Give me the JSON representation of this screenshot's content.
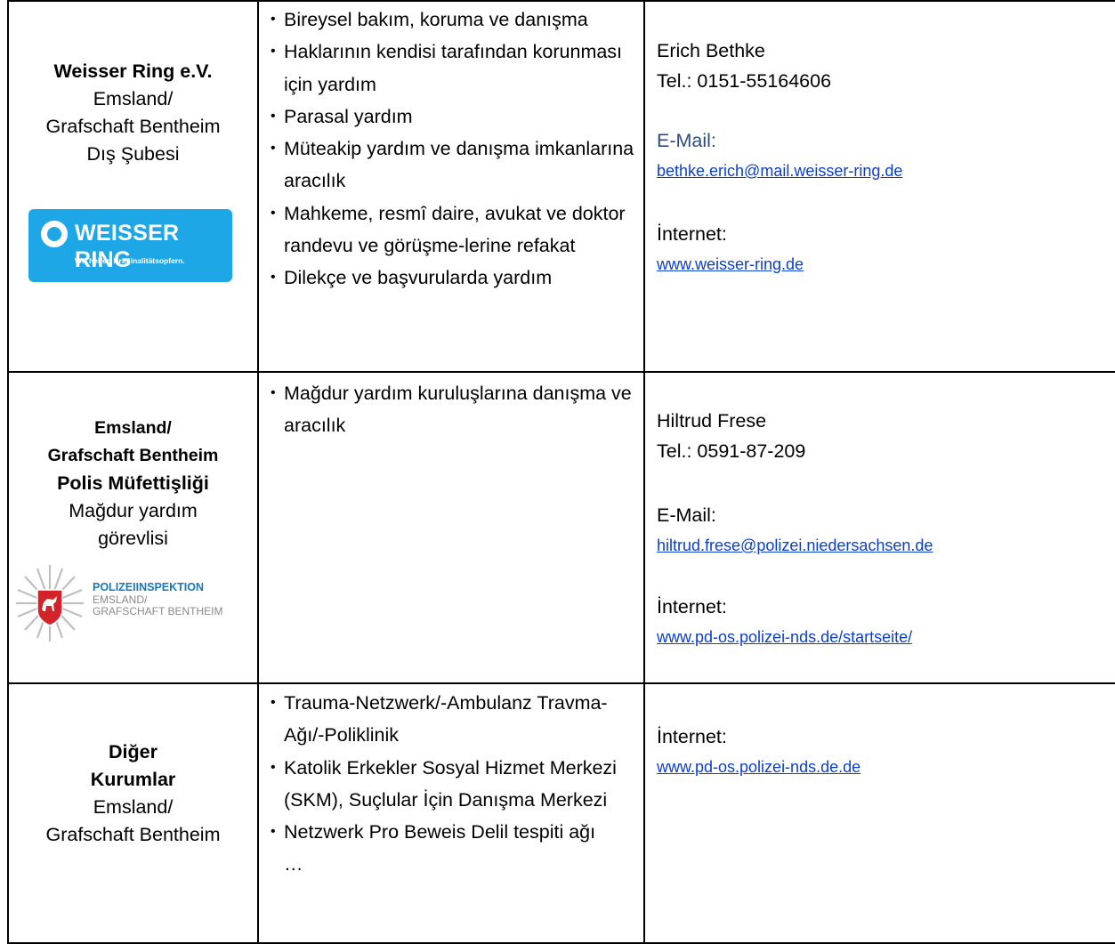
{
  "rows": [
    {
      "org": {
        "bold": [
          "Weisser Ring e.V."
        ],
        "normal": [
          "Emsland/",
          "Grafschaft Bentheim",
          "Dış Şubesi"
        ]
      },
      "logo": {
        "name": "WEISSER RING",
        "tagline": "Wir helfen Kriminalitätsopfern."
      },
      "services": [
        "Bireysel bakım, koruma ve danışma",
        "Haklarının kendisi tarafından korunması için yardım",
        "Parasal yardım",
        "Müteakip yardım ve danışma imkanlarına aracılık",
        "Mahkeme, resmî daire, avukat ve doktor randevu ve görüşme-lerine refakat",
        "Dilekçe ve başvurularda yardım"
      ],
      "contact": {
        "person": "Erich Bethke",
        "phone": "Tel.: 0151-55164606",
        "email_label": "E-Mail:",
        "email": "bethke.erich@mail.weisser-ring.de",
        "internet_label": "İnternet:",
        "website": "www.weisser-ring.de"
      }
    },
    {
      "org": {
        "bold": [
          "Emsland/",
          "Grafschaft Bentheim",
          "Polis Müfettişliği"
        ],
        "normal": [
          "Mağdur yardım",
          "görevlisi"
        ]
      },
      "logo": {
        "line1": "POLIZEIINSPEKTION",
        "line2": "EMSLAND/",
        "line3": "GRAFSCHAFT BENTHEIM"
      },
      "services": [
        "Mağdur yardım kuruluşlarına danışma ve aracılık"
      ],
      "contact": {
        "person": "Hiltrud Frese",
        "phone": "Tel.: 0591-87-209",
        "email_label": "E-Mail:",
        "email": "hiltrud.frese@polizei.niedersachsen.de",
        "internet_label": "İnternet:",
        "website": "www.pd-os.polizei-nds.de/startseite/"
      }
    },
    {
      "org": {
        "bold": [
          "Diğer",
          "Kurumlar"
        ],
        "normal": [
          "Emsland/",
          "Grafschaft Bentheim"
        ]
      },
      "services": [
        "Trauma-Netzwerk/-Ambulanz Travma-Ağı/-Poliklinik",
        "Katolik Erkekler Sosyal Hizmet Merkezi (SKM), Suçlular İçin Danışma Merkezi",
        "Netzwerk Pro Beweis Delil tespiti ağı"
      ],
      "services_more": "…",
      "contact": {
        "internet_label": "İnternet:",
        "website": "www.pd-os.polizei-nds.de.de"
      }
    }
  ],
  "colors": {
    "weisser_ring_blue": "#1EA7E6",
    "link_blue": "#0B3FD1",
    "email_label_blue": "#2E4C80",
    "police_blue": "#1779BE",
    "police_red": "#D2232A"
  }
}
